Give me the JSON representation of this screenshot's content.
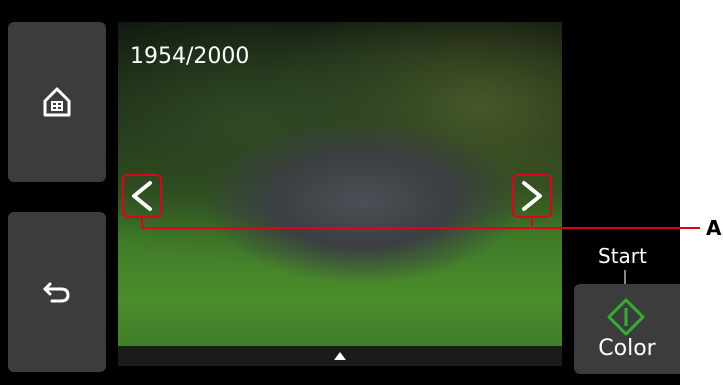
{
  "preview": {
    "counter": "1954/2000",
    "prev_icon": "chevron-left-icon",
    "next_icon": "chevron-right-icon",
    "expand_icon": "triangle-up-icon"
  },
  "sidebar": {
    "home_icon": "home-icon",
    "back_icon": "back-icon"
  },
  "start": {
    "label": "Start",
    "button_label": "Color",
    "icon": "start-diamond-icon"
  },
  "annotation": {
    "callout_label": "A"
  },
  "colors": {
    "highlight": "#e3001b",
    "start_green": "#2fb12f",
    "button_bg": "#3c3c3c"
  }
}
